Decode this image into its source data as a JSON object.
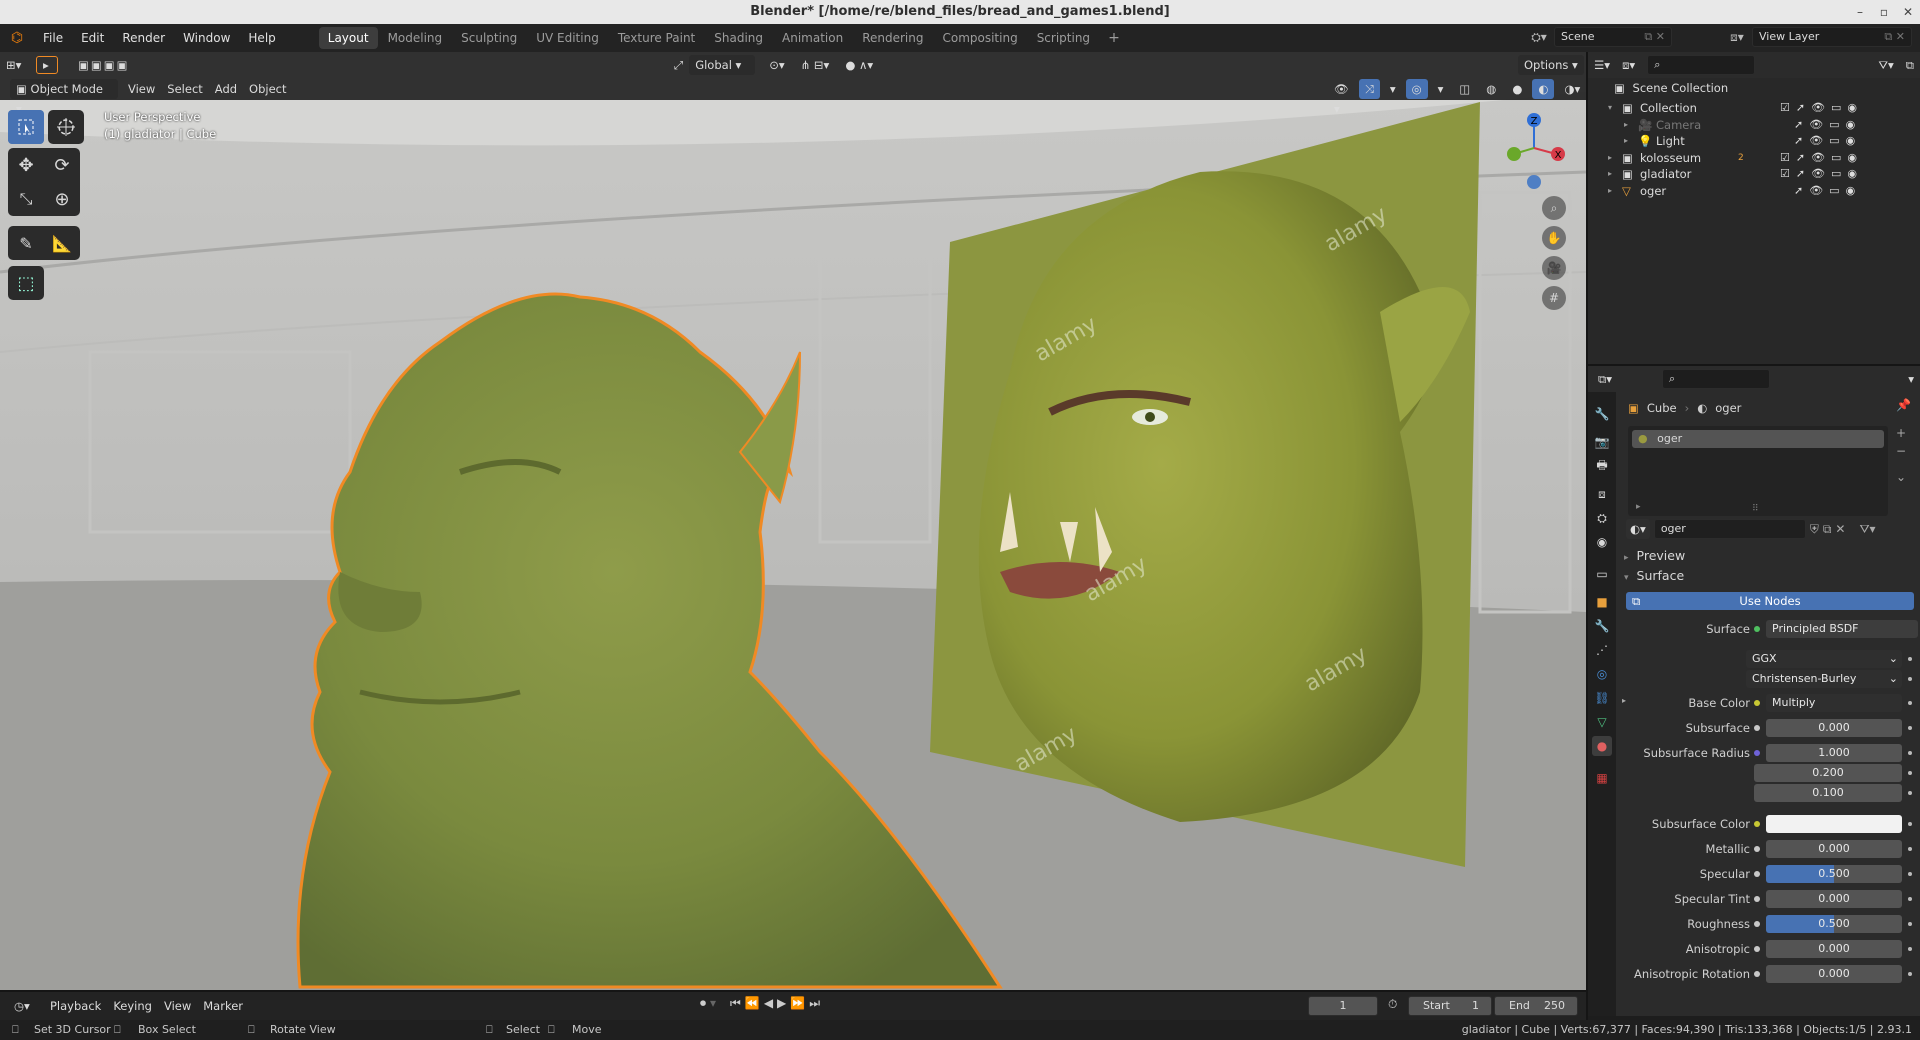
{
  "window": {
    "title": "Blender* [/home/re/blend_files/bread_and_games1.blend]"
  },
  "menu": {
    "items": [
      "File",
      "Edit",
      "Render",
      "Window",
      "Help"
    ]
  },
  "workspaces": [
    {
      "label": "Layout",
      "active": true
    },
    {
      "label": "Modeling"
    },
    {
      "label": "Sculpting"
    },
    {
      "label": "UV Editing"
    },
    {
      "label": "Texture Paint"
    },
    {
      "label": "Shading"
    },
    {
      "label": "Animation"
    },
    {
      "label": "Rendering"
    },
    {
      "label": "Compositing"
    },
    {
      "label": "Scripting"
    }
  ],
  "scene": {
    "name": "Scene",
    "view_layer": "View Layer"
  },
  "viewport": {
    "mode": "Object Mode",
    "menus": [
      "View",
      "Select",
      "Add",
      "Object"
    ],
    "transform_orientation": "Global",
    "options_label": "Options",
    "overlay_title": "User Perspective",
    "overlay_subtitle": "(1) gladiator | Cube",
    "reference_watermark": "alamy",
    "gizmo": {
      "z": "Z",
      "x": "X",
      "y": "Y"
    }
  },
  "outliner": {
    "root": "Scene Collection",
    "items": [
      {
        "label": "Collection",
        "level": 1,
        "type": "collection"
      },
      {
        "label": "Camera",
        "level": 2,
        "type": "camera",
        "dim": true
      },
      {
        "label": "Light",
        "level": 2,
        "type": "light"
      },
      {
        "label": "kolosseum",
        "level": 1,
        "type": "collection"
      },
      {
        "label": "gladiator",
        "level": 1,
        "type": "collection"
      },
      {
        "label": "oger",
        "level": 1,
        "type": "mesh"
      }
    ],
    "badge": "2"
  },
  "properties": {
    "breadcrumb_object": "Cube",
    "breadcrumb_material": "oger",
    "slot": "oger",
    "material_name": "oger",
    "panel_preview": "Preview",
    "panel_surface": "Surface",
    "use_nodes": "Use Nodes",
    "surface_label": "Surface",
    "surface_value": "Principled BSDF",
    "distribution": "GGX",
    "subsurface_method": "Christensen-Burley",
    "fields": [
      {
        "label": "Base Color",
        "value": "Multiply",
        "dot": "#c8c834",
        "type": "sel",
        "expand": true
      },
      {
        "label": "Subsurface",
        "value": "0.000",
        "dot": "#c8c8c8"
      },
      {
        "label": "Subsurface Radius",
        "value": "1.000",
        "dot": "#6e62d8",
        "v2": "0.200",
        "v3": "0.100"
      },
      {
        "label": "Subsurface Color",
        "value": "",
        "dot": "#c8c834",
        "type": "color"
      },
      {
        "label": "Metallic",
        "value": "0.000",
        "dot": "#c8c8c8"
      },
      {
        "label": "Specular",
        "value": "0.500",
        "dot": "#c8c8c8",
        "fill": 0.5
      },
      {
        "label": "Specular Tint",
        "value": "0.000",
        "dot": "#c8c8c8"
      },
      {
        "label": "Roughness",
        "value": "0.500",
        "dot": "#c8c8c8",
        "fill": 0.5
      },
      {
        "label": "Anisotropic",
        "value": "0.000",
        "dot": "#c8c8c8"
      },
      {
        "label": "Anisotropic Rotation",
        "value": "0.000",
        "dot": "#c8c8c8"
      }
    ]
  },
  "timeline": {
    "menus": [
      "Playback",
      "Keying",
      "View",
      "Marker"
    ],
    "current_frame": "1",
    "start_label": "Start",
    "start": "1",
    "end_label": "End",
    "end": "250"
  },
  "status": {
    "hints": [
      "Set 3D Cursor",
      "Box Select",
      "Rotate View",
      "Select",
      "Move"
    ],
    "info": "gladiator | Cube | Verts:67,377 | Faces:94,390 | Tris:133,368 | Objects:1/5 | 2.93.1"
  },
  "colors": {
    "accent": "#4772b3",
    "orc_skin": "#8a9a3c",
    "selection_outline": "#f08a24"
  }
}
